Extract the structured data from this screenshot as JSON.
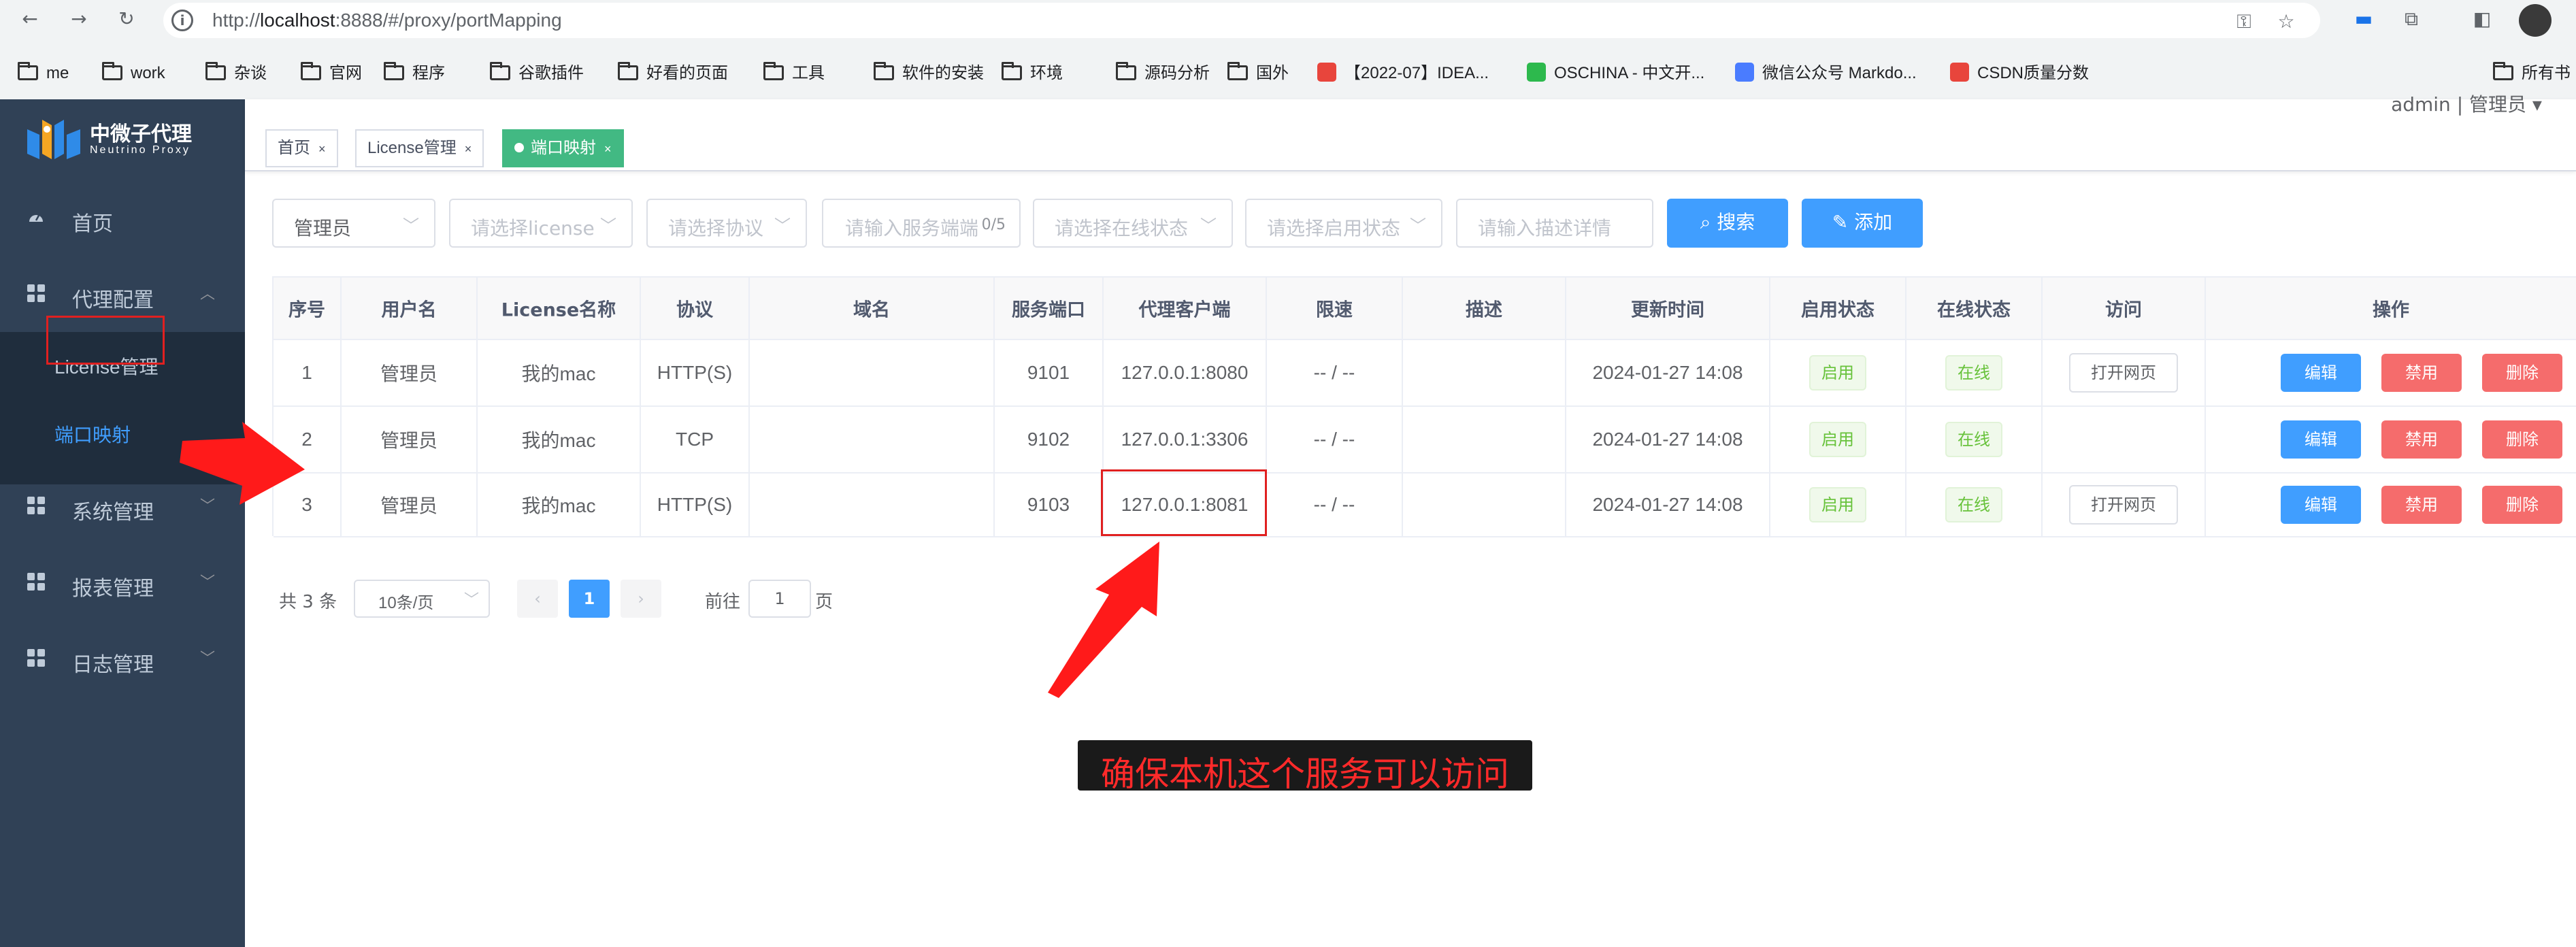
{
  "browser": {
    "url_prefix": "http://",
    "url_host": "localhost",
    "url_rest": ":8888/#/proxy/portMapping",
    "bookmarks": [
      {
        "label": "me",
        "type": "folder"
      },
      {
        "label": "work",
        "type": "folder"
      },
      {
        "label": "杂谈",
        "type": "folder"
      },
      {
        "label": "官网",
        "type": "folder"
      },
      {
        "label": "程序",
        "type": "folder"
      },
      {
        "label": "谷歌插件",
        "type": "folder"
      },
      {
        "label": "好看的页面",
        "type": "folder"
      },
      {
        "label": "工具",
        "type": "folder"
      },
      {
        "label": "软件的安装",
        "type": "folder"
      },
      {
        "label": "环境",
        "type": "folder"
      },
      {
        "label": "源码分析",
        "type": "folder"
      },
      {
        "label": "国外",
        "type": "folder"
      },
      {
        "label": "【2022-07】IDEA...",
        "type": "favicon",
        "icon": "idea-icon",
        "color": "#e8453c"
      },
      {
        "label": "OSCHINA - 中文开...",
        "type": "favicon",
        "icon": "oschina-icon",
        "color": "#2db94d"
      },
      {
        "label": "微信公众号 Markdo...",
        "type": "favicon",
        "icon": "markdown-icon",
        "color": "#4a7cff"
      },
      {
        "label": "CSDN质量分数",
        "type": "favicon",
        "icon": "csdn-icon",
        "color": "#e8453c"
      },
      {
        "label": "所有书",
        "type": "folder"
      }
    ]
  },
  "app": {
    "logo_title": "中微子代理",
    "logo_subtitle": "Neutrino Proxy",
    "user_info": "admin | 管理员 ▾"
  },
  "sidebar": {
    "items": [
      {
        "label": "首页",
        "icon": "dashboard-icon"
      },
      {
        "label": "代理配置",
        "icon": "grid-icon",
        "expanded": true
      },
      {
        "label": "系统管理",
        "icon": "grid-icon"
      },
      {
        "label": "报表管理",
        "icon": "grid-icon"
      },
      {
        "label": "日志管理",
        "icon": "grid-icon"
      }
    ],
    "submenu": [
      {
        "label": "License管理"
      },
      {
        "label": "端口映射",
        "active": true
      }
    ],
    "active_color": "#409eff"
  },
  "tags": [
    {
      "label": "首页"
    },
    {
      "label": "License管理"
    },
    {
      "label": "端口映射",
      "active": true
    }
  ],
  "filters": {
    "user": "管理员",
    "license_placeholder": "请选择license",
    "protocol_placeholder": "请选择协议",
    "port_placeholder": "请输入服务端端",
    "port_count": "0/5",
    "online_placeholder": "请选择在线状态",
    "enable_placeholder": "请选择启用状态",
    "desc_placeholder": "请输入描述详情",
    "search_label": "搜索",
    "add_label": "添加"
  },
  "table": {
    "headers": [
      "序号",
      "用户名",
      "License名称",
      "协议",
      "域名",
      "服务端口",
      "代理客户端",
      "限速",
      "描述",
      "更新时间",
      "启用状态",
      "在线状态",
      "访问",
      "操作"
    ],
    "rows": [
      {
        "index": "1",
        "user": "管理员",
        "license": "我的mac",
        "protocol": "HTTP(S)",
        "domain": "",
        "port": "9101",
        "client": "127.0.0.1:8080",
        "rate": "-- / --",
        "desc": "",
        "time": "2024-01-27 14:08",
        "enabled": "启用",
        "online": "在线",
        "visit": "打开网页"
      },
      {
        "index": "2",
        "user": "管理员",
        "license": "我的mac",
        "protocol": "TCP",
        "domain": "",
        "port": "9102",
        "client": "127.0.0.1:3306",
        "rate": "-- / --",
        "desc": "",
        "time": "2024-01-27 14:08",
        "enabled": "启用",
        "online": "在线",
        "visit": ""
      },
      {
        "index": "3",
        "user": "管理员",
        "license": "我的mac",
        "protocol": "HTTP(S)",
        "domain": "",
        "port": "9103",
        "client": "127.0.0.1:8081",
        "rate": "-- / --",
        "desc": "",
        "time": "2024-01-27 14:08",
        "enabled": "启用",
        "online": "在线",
        "visit": "打开网页"
      }
    ],
    "ops": {
      "edit": "编辑",
      "disable": "禁用",
      "delete": "删除"
    }
  },
  "pagination": {
    "total": "共 3 条",
    "page_size": "10条/页",
    "current_page": "1",
    "goto_label": "前往",
    "goto_value": "1",
    "page_suffix": "页"
  },
  "annotation": {
    "caption": "确保本机这个服务可以访问",
    "color": "#ff2a2a"
  }
}
